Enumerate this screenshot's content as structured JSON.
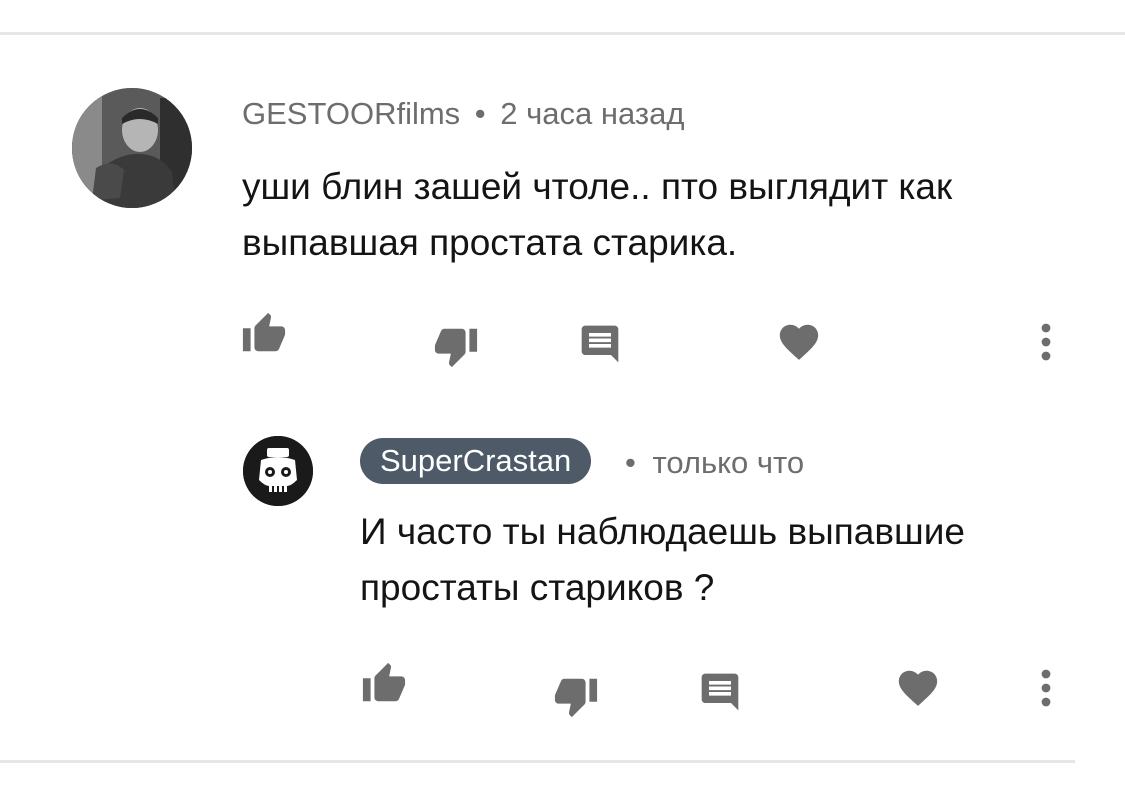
{
  "comment": {
    "author": "GESTOORfilms",
    "separator": "•",
    "time": "2 часа назад",
    "text": "уши блин зашей чтоле.. пто выглядит как выпавшая простата старика."
  },
  "reply": {
    "author": "SuperCrastan",
    "separator": "•",
    "time": "только что",
    "text": "И часто ты наблюдаешь выпавшие простаты стариков ?"
  },
  "icons": {
    "like": "thumbs-up-icon",
    "dislike": "thumbs-down-icon",
    "reply": "comment-icon",
    "heart": "heart-icon",
    "more": "more-vertical-icon"
  },
  "colors": {
    "author_pill": "#4e5a68",
    "icon": "#6d6d6d",
    "text": "#141414",
    "meta": "#6d6d6d"
  }
}
